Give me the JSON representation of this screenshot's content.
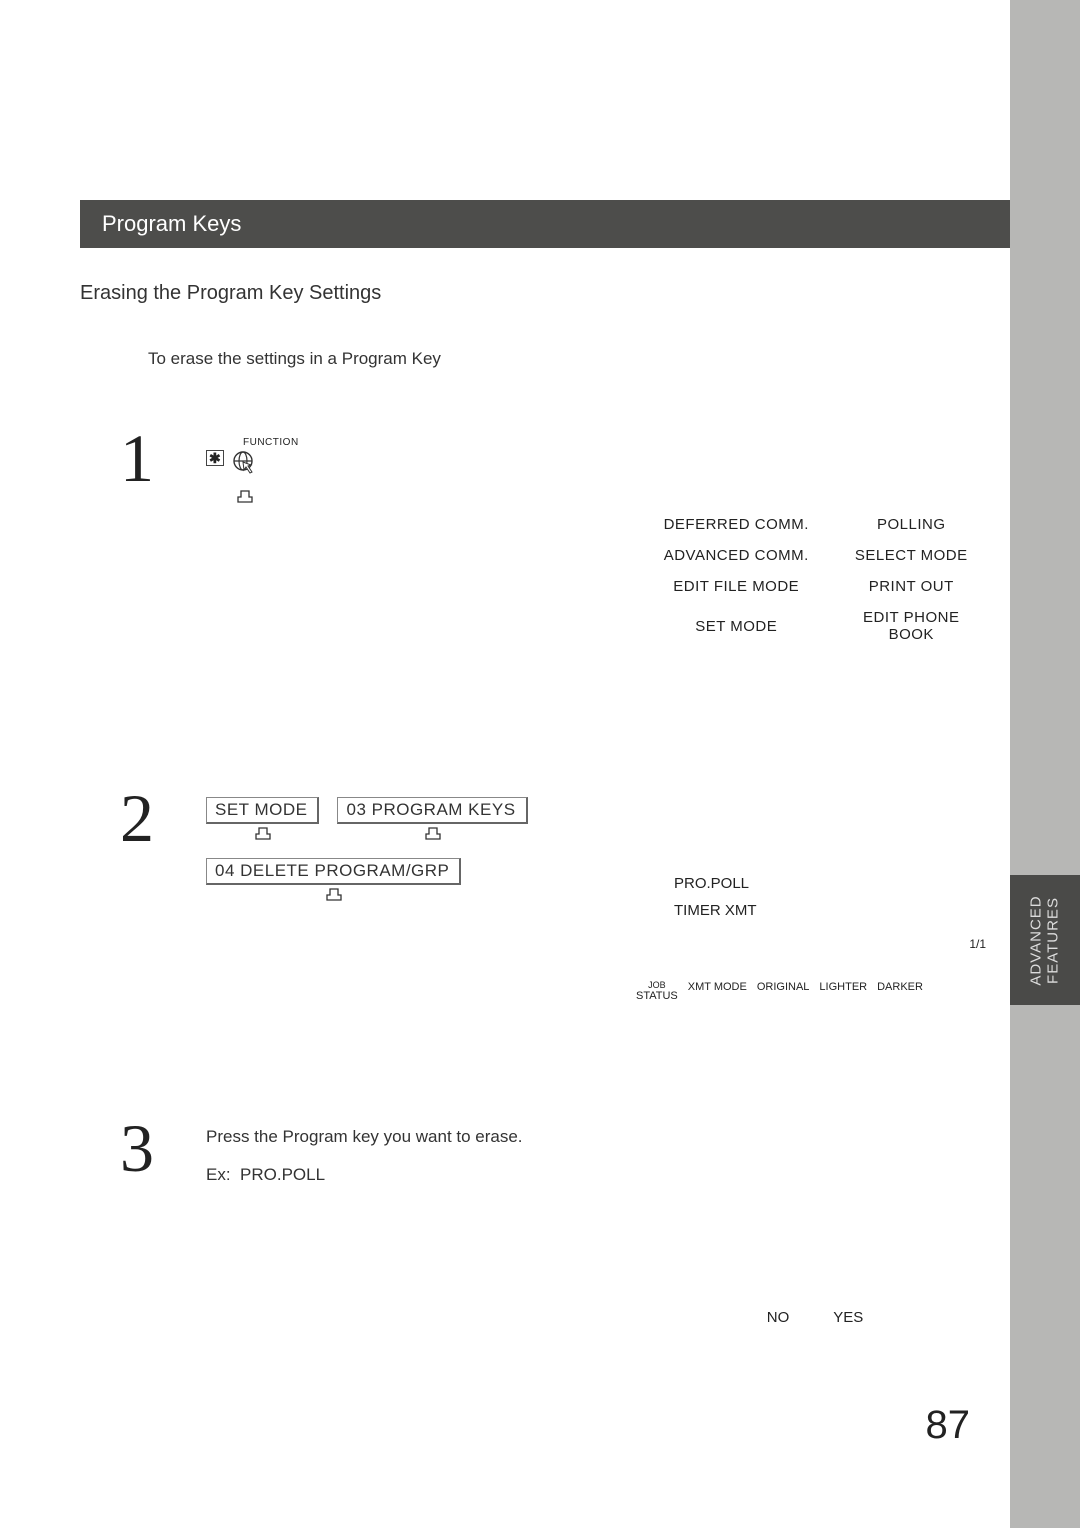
{
  "banner_title": "Program Keys",
  "subtitle": "Erasing the Program Key Settings",
  "intro_line": "To erase the settings in a Program Key",
  "side_tab": "ADVANCED\nFEATURES",
  "page_number": "87",
  "step1": {
    "num": "1",
    "function_label": "FUNCTION",
    "asterisk": "✱",
    "display": {
      "rows": [
        {
          "l": "DEFERRED COMM.",
          "r": "POLLING"
        },
        {
          "l": "ADVANCED COMM.",
          "r": "SELECT MODE"
        },
        {
          "l": "EDIT FILE MODE",
          "r": "PRINT OUT"
        },
        {
          "l": "SET MODE",
          "r": "EDIT PHONE BOOK"
        }
      ]
    }
  },
  "step2": {
    "num": "2",
    "keys": {
      "set_mode": "SET MODE",
      "program_keys": "03 PROGRAM KEYS",
      "delete_grp": "04 DELETE PROGRAM/GRP"
    },
    "panel": {
      "items": [
        "PRO.POLL",
        "TIMER XMT"
      ],
      "page_indicator": "1/1",
      "softkeys": [
        {
          "top": "JOB",
          "bottom": "STATUS"
        },
        {
          "top": "",
          "bottom": "XMT MODE"
        },
        {
          "top": "",
          "bottom": "ORIGINAL"
        },
        {
          "top": "",
          "bottom": "LIGHTER"
        },
        {
          "top": "",
          "bottom": "DARKER"
        }
      ]
    }
  },
  "step3": {
    "num": "3",
    "line1": "Press the Program key you want to erase.",
    "line2_prefix": "Ex:",
    "line2_key": "PRO.POLL",
    "panel": {
      "no": "NO",
      "yes": "YES"
    }
  }
}
